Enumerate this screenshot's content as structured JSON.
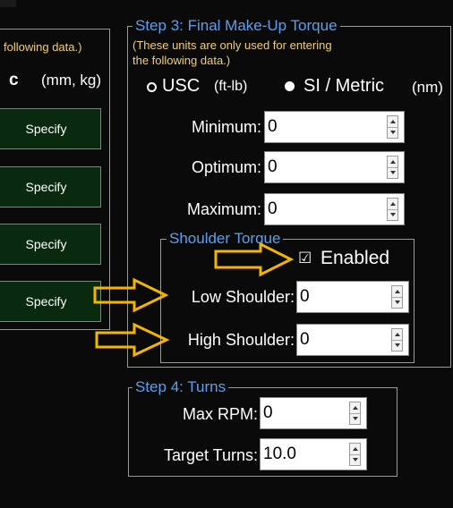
{
  "left_panel": {
    "note": "following data.)",
    "unit_label": "(mm, kg)",
    "unit_partial": "c",
    "buttons": [
      "Specify",
      "Specify",
      "Specify",
      "Specify"
    ]
  },
  "step3": {
    "title": "Step 3: Final Make-Up Torque",
    "note_line1": "(These units are only used for entering",
    "note_line2": "the following data.)",
    "radio_usc_label": "USC",
    "radio_usc_unit": "(ft-lb)",
    "radio_si_label": "SI / Metric",
    "radio_si_unit": "(nm)",
    "selected_unit": "SI / Metric",
    "fields": [
      {
        "label": "Minimum:",
        "value": "0"
      },
      {
        "label": "Optimum:",
        "value": "0"
      },
      {
        "label": "Maximum:",
        "value": "0"
      }
    ]
  },
  "shoulder": {
    "title": "Shoulder Torque",
    "enabled_label": "Enabled",
    "enabled_checked": true,
    "checkbox_glyph": "☑",
    "fields": [
      {
        "label": "Low Shoulder:",
        "value": "0"
      },
      {
        "label": "High Shoulder:",
        "value": "0"
      }
    ]
  },
  "step4": {
    "title": "Step 4: Turns",
    "fields": [
      {
        "label": "Max RPM:",
        "value": "0"
      },
      {
        "label": "Target Turns:",
        "value": "10.0"
      }
    ]
  },
  "colors": {
    "legend": "#5aa0f0",
    "note": "#f0d070",
    "button_bg": "#0a2a10",
    "arrow": "#f2b600"
  }
}
